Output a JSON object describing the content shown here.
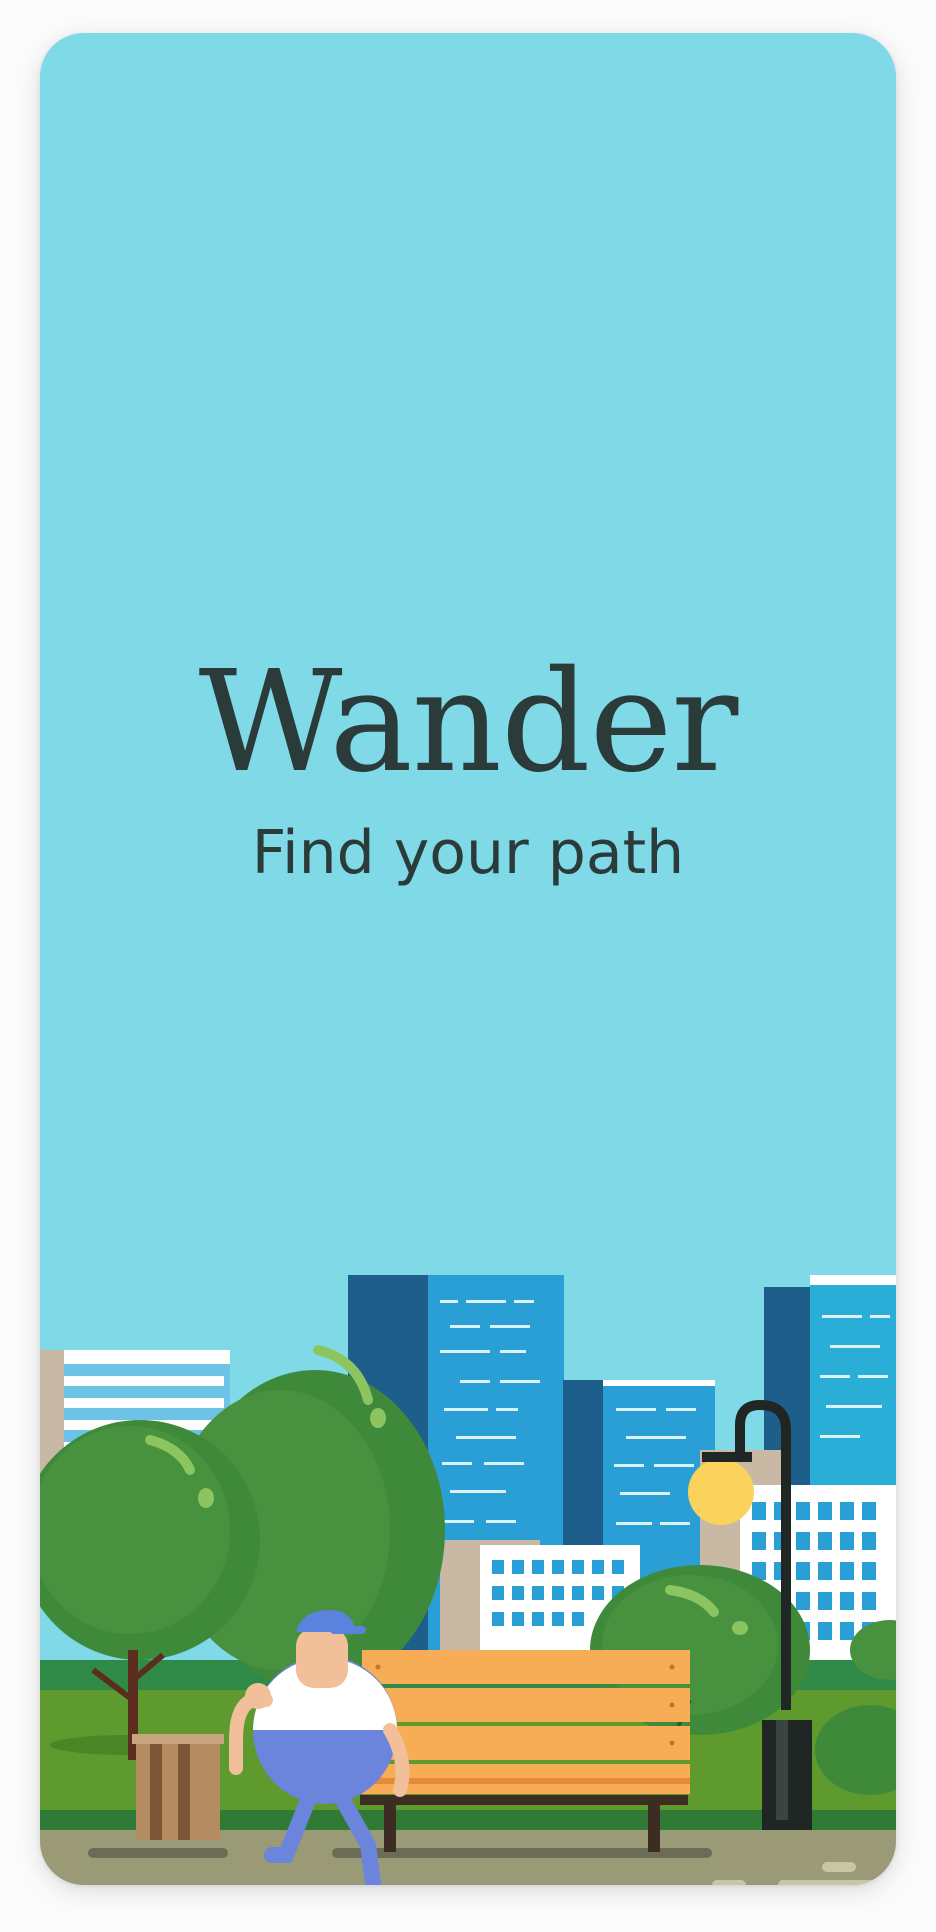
{
  "splash": {
    "app_title": "Wander",
    "tagline": "Find your path"
  },
  "illustration": {
    "subject": "city-park",
    "elements": [
      "skyline-buildings",
      "trees",
      "park-bench",
      "street-lamp",
      "trash-bin",
      "walking-person"
    ]
  },
  "colors": {
    "sky": "#7fd9e7",
    "text": "#2b3b3a",
    "grass": "#5e9a2e",
    "tree": "#3f8a3a",
    "bench": "#f6ad55",
    "path": "#9b9a76"
  }
}
